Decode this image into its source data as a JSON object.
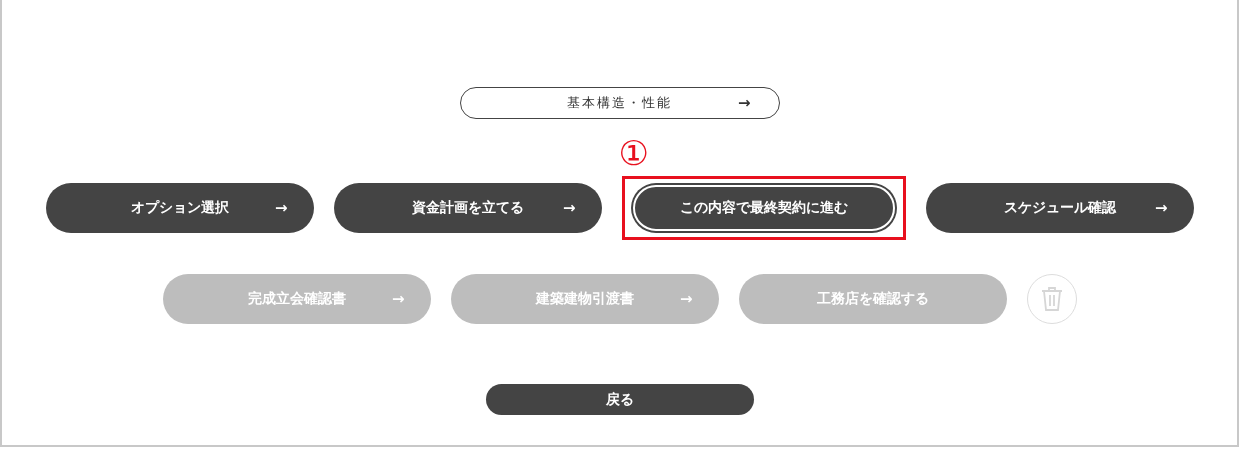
{
  "top_button": {
    "label": "基本構造・性能",
    "arrow": "→"
  },
  "annotation": {
    "label": "①"
  },
  "rows": [
    [
      {
        "label": "オプション選択",
        "arrow": "→",
        "disabled": false,
        "highlighted": false
      },
      {
        "label": "資金計画を立てる",
        "arrow": "→",
        "disabled": false,
        "highlighted": false
      },
      {
        "label": "この内容で最終契約に進む",
        "disabled": false,
        "highlighted": true
      },
      {
        "label": "スケジュール確認",
        "arrow": "→",
        "disabled": false,
        "highlighted": false
      }
    ],
    [
      {
        "label": "完成立会確認書",
        "arrow": "→",
        "disabled": true,
        "highlighted": false
      },
      {
        "label": "建築建物引渡書",
        "arrow": "→",
        "disabled": true,
        "highlighted": false
      },
      {
        "label": "工務店を確認する",
        "disabled": true,
        "highlighted": false
      }
    ]
  ],
  "delete_button": {
    "disabled": true
  },
  "back_button": {
    "label": "戻る"
  }
}
